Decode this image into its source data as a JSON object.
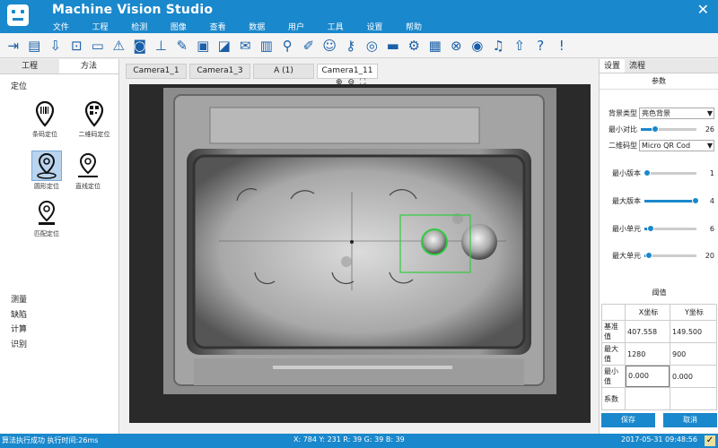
{
  "app": {
    "title": "Machine Vision Studio"
  },
  "menu": [
    "文件",
    "工程",
    "检测",
    "图像",
    "查看",
    "数据",
    "用户",
    "工具",
    "设置",
    "帮助"
  ],
  "toolbar_icons": [
    "arrow-right-icon",
    "document-icon",
    "import-icon",
    "lock-icon",
    "monitor-icon",
    "warning-icon",
    "camera-icon",
    "hierarchy-icon",
    "pen-icon",
    "picture-icon",
    "image-edit-icon",
    "mail-icon",
    "bar-chart-icon",
    "magnifier-icon",
    "edit-icon",
    "user-icon",
    "key-user-icon",
    "target-icon",
    "ruler-icon",
    "gear-icon",
    "layout-icon",
    "network-icon",
    "broadcast-icon",
    "bell-icon",
    "up-arrow-icon",
    "help-icon",
    "alert-icon"
  ],
  "left": {
    "tabs": [
      "工程",
      "方法"
    ],
    "active_tab": "方法",
    "section_locate": "定位",
    "tools": [
      {
        "label": "条码定位",
        "icon": "barcode-locate-icon"
      },
      {
        "label": "二维码定位",
        "icon": "qrcode-locate-icon"
      },
      {
        "label": "圆形定位",
        "icon": "circle-locate-icon"
      },
      {
        "label": "直线定位",
        "icon": "line-locate-icon"
      },
      {
        "label": "匹配定位",
        "icon": "match-locate-icon"
      }
    ],
    "sections": [
      "测量",
      "缺陷",
      "计算",
      "识别"
    ]
  },
  "center": {
    "tabs": [
      "Camera1_1",
      "Camera1_3",
      "A (1)",
      "Camera1_11"
    ],
    "active_tab": "Camera1_11",
    "zoom": [
      "⊕",
      "⊖",
      "⛶"
    ]
  },
  "right": {
    "tabs": [
      "设置",
      "流程"
    ],
    "header": "参数",
    "background_type_label": "背景类型",
    "background_type_value": "亮色背景",
    "min_contrast_label": "最小对比",
    "min_contrast_value": "26",
    "min_contrast_level": 0.26,
    "code_type_label": "二维码型",
    "code_type_value": "Micro QR Cod",
    "params": [
      {
        "label": "最小版本",
        "value": "1",
        "level": 0.05
      },
      {
        "label": "最大版本",
        "value": "4",
        "level": 0.98
      },
      {
        "label": "最小单元",
        "value": "6",
        "level": 0.12
      },
      {
        "label": "最大单元",
        "value": "20",
        "level": 0.08
      }
    ],
    "threshold_header": "阈值",
    "table": {
      "headers": [
        "",
        "X坐标",
        "Y坐标"
      ],
      "rows": [
        [
          "基准值",
          "407.558",
          "149.500"
        ],
        [
          "最大值",
          "1280",
          "900"
        ],
        [
          "最小值",
          "0.000",
          "0.000"
        ],
        [
          "系数",
          "",
          ""
        ]
      ]
    },
    "save_label": "保存",
    "cancel_label": "取消"
  },
  "status": {
    "message": "算法执行成功 执行时间:26ms",
    "pixel": "X: 784 Y: 231   R: 39 G: 39 B: 39",
    "datetime": "2017-05-31 09:48:56"
  }
}
